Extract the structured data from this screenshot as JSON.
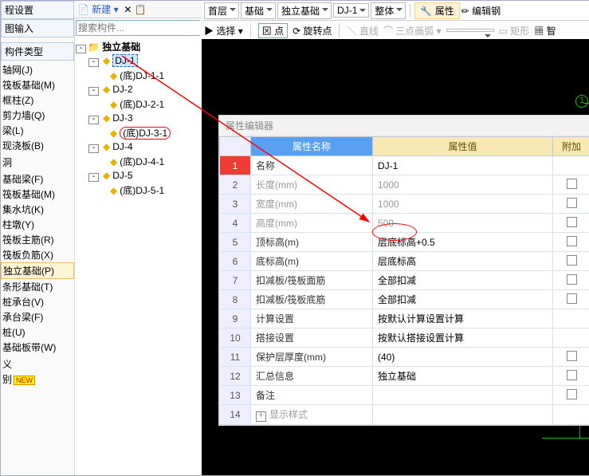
{
  "lefttabs": {
    "a": "程设置",
    "b": "图输入"
  },
  "leftgroups": {
    "a": "构件类型"
  },
  "leftitems": [
    "轴网(J)",
    "筏板基础(M)",
    "框柱(Z)",
    "剪力墙(Q)",
    "梁(L)",
    "现浇板(B)",
    "",
    "洞",
    "",
    "基础梁(F)",
    "筏板基础(M)",
    "集水坑(K)",
    "柱墩(Y)",
    "筏板主筋(R)",
    "筏板负筋(X)",
    "独立基础(P)",
    "条形基础(T)",
    "桩承台(V)",
    "承台梁(F)",
    "桩(U)",
    "基础板带(W)",
    "",
    "义",
    "别"
  ],
  "selIndex": 15,
  "mid": {
    "new": "新建",
    "placeholder": "搜索构件...",
    "root": "独立基础",
    "nodes": [
      {
        "name": "DJ-1",
        "child": "(底)DJ-1-1",
        "sel": true
      },
      {
        "name": "DJ-2",
        "child": "(底)DJ-2-1"
      },
      {
        "name": "DJ-3",
        "child": "(底)DJ-3-1",
        "hl": true
      },
      {
        "name": "DJ-4",
        "child": "(底)DJ-4-1"
      },
      {
        "name": "DJ-5",
        "child": "(底)DJ-5-1"
      }
    ]
  },
  "ribbon": {
    "floor": "首层",
    "a": "基础",
    "b": "独立基础",
    "c": "DJ-1",
    "d": "整体",
    "prop": "属性",
    "edit": "编辑钢"
  },
  "ribbon2": {
    "sel": "选择",
    "pt": "点",
    "rot": "旋转点",
    "line": "直线",
    "arc": "三点画弧",
    "rect": "矩形",
    "smart": "智"
  },
  "prop": {
    "title": "属性编辑器",
    "headName": "属性名称",
    "headVal": "属性值",
    "headExtra": "附加",
    "rows": [
      {
        "n": "名称",
        "v": "DJ-1",
        "hrow": true,
        "nochk": true
      },
      {
        "n": "长度(mm)",
        "v": "1000",
        "gray": true
      },
      {
        "n": "宽度(mm)",
        "v": "1000",
        "gray": true
      },
      {
        "n": "高度(mm)",
        "v": "500",
        "gray": true
      },
      {
        "n": "顶标高(m)",
        "v": "层底标高+0.5",
        "circle": true
      },
      {
        "n": "底标高(m)",
        "v": "层底标高"
      },
      {
        "n": "扣减板/筏板面筋",
        "v": "全部扣减"
      },
      {
        "n": "扣减板/筏板底筋",
        "v": "全部扣减"
      },
      {
        "n": "计算设置",
        "v": "按默认计算设置计算",
        "nochk": true
      },
      {
        "n": "搭接设置",
        "v": "按默认搭接设置计算",
        "nochk": true
      },
      {
        "n": "保护层厚度(mm)",
        "v": "(40)"
      },
      {
        "n": "汇总信息",
        "v": "独立基础"
      },
      {
        "n": "备注",
        "v": ""
      },
      {
        "n": "显示样式",
        "v": "",
        "plus": true,
        "gray": true,
        "nochk": true
      }
    ]
  }
}
